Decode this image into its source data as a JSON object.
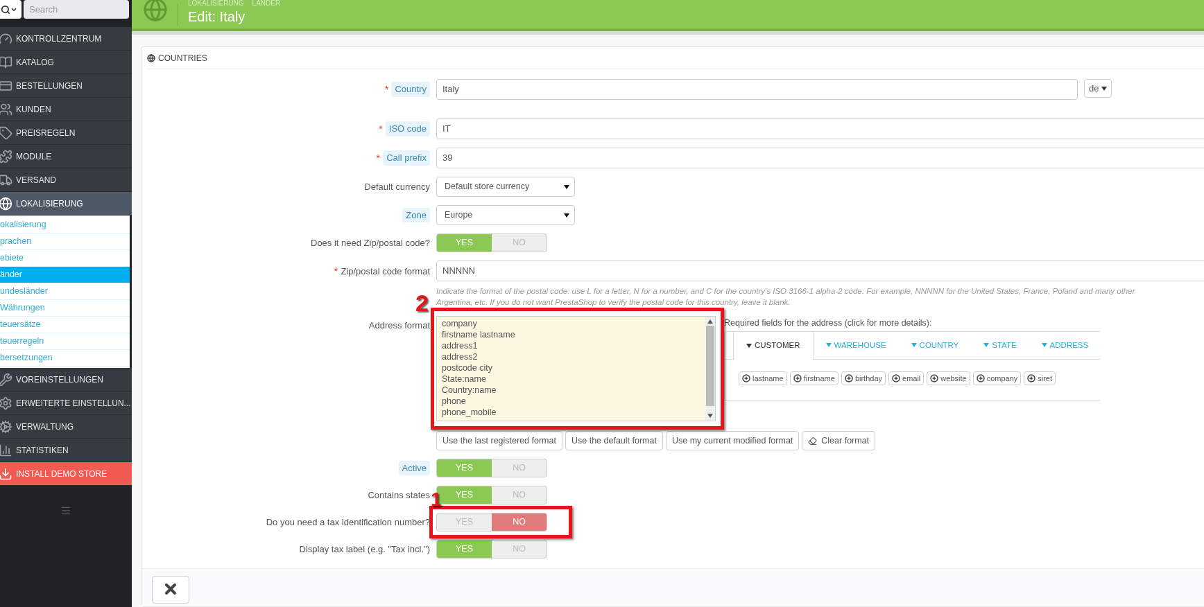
{
  "sidebar": {
    "search": {
      "placeholder": "Search"
    },
    "items": [
      {
        "label": "KONTROLLZENTRUM",
        "selected": false
      },
      {
        "label": "KATALOG",
        "selected": false
      },
      {
        "label": "BESTELLUNGEN",
        "selected": false
      },
      {
        "label": "KUNDEN",
        "selected": false
      },
      {
        "label": "PREISREGELN",
        "selected": false
      },
      {
        "label": "MODULE",
        "selected": false
      },
      {
        "label": "VERSAND",
        "selected": false
      },
      {
        "label": "LOKALISIERUNG",
        "selected": true,
        "children": [
          {
            "label": "okalisierung",
            "selected": false
          },
          {
            "label": "prachen",
            "selected": false
          },
          {
            "label": "ebiete",
            "selected": false
          },
          {
            "label": "änder",
            "selected": true
          },
          {
            "label": "undesländer",
            "selected": false
          },
          {
            "label": "Währungen",
            "selected": false
          },
          {
            "label": "teuersätze",
            "selected": false
          },
          {
            "label": "teuerregeln",
            "selected": false
          },
          {
            "label": "bersetzungen",
            "selected": false
          }
        ]
      },
      {
        "label": "VOREINSTELLUNGEN",
        "selected": false
      },
      {
        "label": "ERWEITERTE EINSTELLUN...",
        "selected": false
      },
      {
        "label": "VERWALTUNG",
        "selected": false
      },
      {
        "label": "STATISTIKEN",
        "selected": false
      },
      {
        "label": "INSTALL DEMO STORE",
        "selected": false,
        "kind": "alert"
      }
    ]
  },
  "header": {
    "breadcrumb": [
      "LOKALISIERUNG",
      "LÄNDER"
    ],
    "title": "Edit: Italy"
  },
  "panel": {
    "title": "COUNTRIES",
    "fields": [
      {
        "kind": "text",
        "label": "Country",
        "required_mark": "*",
        "hint": true,
        "value": "Italy",
        "language": "de"
      },
      {
        "kind": "text",
        "label": "ISO code",
        "required_mark": "*",
        "hint": true,
        "value": "IT"
      },
      {
        "kind": "text",
        "label": "Call prefix",
        "required_mark": "*",
        "hint": true,
        "value": "39"
      },
      {
        "kind": "select",
        "label": "Default currency",
        "hint": false,
        "value": "Default store currency"
      },
      {
        "kind": "select",
        "label": "Zone",
        "hint": true,
        "value": "Europe"
      },
      {
        "kind": "toggle",
        "label": "Does it need Zip/postal code?",
        "hint": false,
        "on": true,
        "yes": "YES",
        "no": "NO"
      },
      {
        "kind": "text",
        "label": "Zip/postal code format",
        "required_mark": "*",
        "hint": false,
        "value": "NNNNN",
        "help": [
          "Indicate the format of the postal code: use L for a letter, N for a number, and C for the country's ISO 3166-1 alpha-2 code. For example, NNNNN for the United States, France, Poland and many other",
          "Argentina, etc. If you do not want PrestaShop to verify the postal code for this country, leave it blank."
        ]
      },
      {
        "kind": "address",
        "label": "Address format",
        "hint": false,
        "annotation": "2",
        "lines": [
          "company",
          "firstname lastname",
          "address1",
          "address2",
          "postcode city",
          "State:name",
          "Country:name",
          "phone",
          "phone_mobile"
        ],
        "required_title": "Required fields for the address (click for more details):",
        "tabs": [
          {
            "label": "CUSTOMER",
            "selected": true
          },
          {
            "label": "WAREHOUSE",
            "selected": false
          },
          {
            "label": "COUNTRY",
            "selected": false
          },
          {
            "label": "STATE",
            "selected": false
          },
          {
            "label": "ADDRESS",
            "selected": false
          }
        ],
        "field_buttons": [
          "lastname",
          "firstname",
          "birthday",
          "email",
          "website",
          "company",
          "siret"
        ],
        "actions": [
          {
            "label": "Use the last registered format",
            "kind": "plain"
          },
          {
            "label": "Use the default format",
            "kind": "plain"
          },
          {
            "label": "Use my current modified format",
            "kind": "plain"
          },
          {
            "label": "Clear format",
            "kind": "eraser"
          }
        ]
      },
      {
        "kind": "toggle",
        "label": "Active",
        "hint": true,
        "on": true,
        "yes": "YES",
        "no": "NO"
      },
      {
        "kind": "toggle",
        "label": "Contains states",
        "hint": false,
        "on": true,
        "yes": "YES",
        "no": "NO"
      },
      {
        "kind": "toggle",
        "label": "Do you need a tax identification number?",
        "hint": false,
        "on": false,
        "yes": "YES",
        "no": "NO",
        "annotation": "1"
      },
      {
        "kind": "toggle",
        "label": "Display tax label (e.g. \"Tax incl.\")",
        "hint": false,
        "on": true,
        "yes": "YES",
        "no": "NO"
      }
    ]
  }
}
